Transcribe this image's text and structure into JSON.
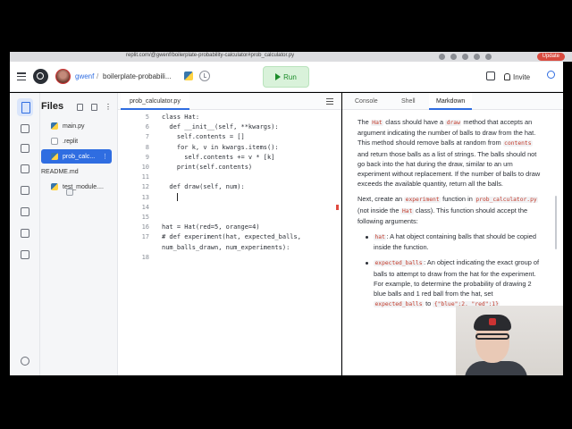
{
  "browser": {
    "url": "replit.com/@gwenf/boilerplate-probability-calculator#prob_calculator.py",
    "update_label": "Update"
  },
  "header": {
    "username": "gwenf",
    "separator": "/",
    "repl_name": "boilerplate-probabili...",
    "run_label": "Run",
    "invite_label": "Invite"
  },
  "files": {
    "title": "Files",
    "items": [
      {
        "name": "main.py",
        "type": "py"
      },
      {
        "name": ".replit",
        "type": "dot"
      },
      {
        "name": "prob_calc...",
        "type": "py"
      },
      {
        "name": "README.md",
        "type": "md"
      },
      {
        "name": "test_module....",
        "type": "py"
      }
    ],
    "selected_index": 2,
    "kebab": "⋮"
  },
  "editor": {
    "tab_label": "prob_calculator.py",
    "lines": [
      {
        "n": "5",
        "text": "class Hat:"
      },
      {
        "n": "6",
        "text": "  def __init__(self, **kwargs):"
      },
      {
        "n": "7",
        "text": "    self.contents = []"
      },
      {
        "n": "8",
        "text": "    for k, v in kwargs.items():"
      },
      {
        "n": "9",
        "text": "      self.contents += v * [k]"
      },
      {
        "n": "10",
        "text": "    print(self.contents)"
      },
      {
        "n": "11",
        "text": ""
      },
      {
        "n": "12",
        "text": "  def draw(self, num):"
      },
      {
        "n": "13",
        "text": "    "
      },
      {
        "n": "14",
        "text": ""
      },
      {
        "n": "15",
        "text": ""
      },
      {
        "n": "16",
        "text": "hat = Hat(red=5, orange=4)"
      },
      {
        "n": "17",
        "text": "# def experiment(hat, expected_balls,"
      },
      {
        "n": "",
        "text": "num_balls_drawn, num_experiments):"
      },
      {
        "n": "18",
        "text": ""
      }
    ]
  },
  "right_pane": {
    "tabs": [
      "Console",
      "Shell",
      "Markdown"
    ],
    "active_tab": "Markdown",
    "md": {
      "p1": {
        "t1": "The ",
        "c1": "Hat",
        "t2": " class should have a ",
        "c2": "draw",
        "t3": " method that accepts an argument indicating the number of balls to draw from the hat. This method should remove balls at random from ",
        "c3": "contents",
        "t4": " and return those balls as a list of strings. The balls should not go back into the hat during the draw, similar to an urn experiment without replacement. If the number of balls to draw exceeds the available quantity, return all the balls."
      },
      "p2": {
        "t1": "Next, create an ",
        "c1": "experiment",
        "t2": " function in ",
        "c2": "prob_calculator.py",
        "t3": " (not inside the ",
        "c3": "Hat",
        "t4": " class). This function should accept the following arguments:"
      },
      "li1": {
        "c1": "hat",
        "t1": ": A hat object containing balls that should be copied inside the function."
      },
      "li2": {
        "c1": "expected_balls",
        "t1": ": An object indicating the exact group of balls to attempt to draw from the hat for the experiment. For example, to determine the probability of drawing 2 blue balls and 1 red ball from the hat, set ",
        "c2": "expected_balls",
        "t2": " to ",
        "c3": "{\"blue\":2, \"red\":1}"
      }
    }
  }
}
